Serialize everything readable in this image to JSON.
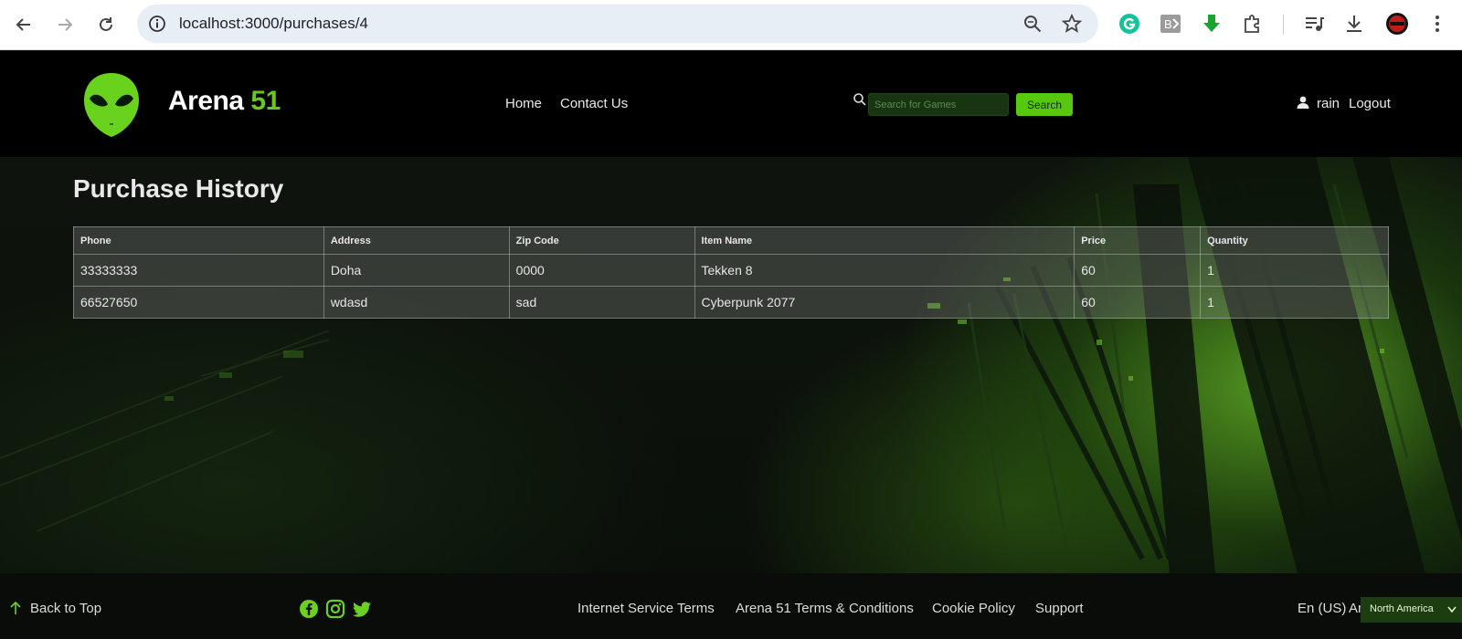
{
  "browser": {
    "url": "localhost:3000/purchases/4"
  },
  "header": {
    "brand_main": "Arena",
    "brand_accent": "51",
    "nav": [
      "Home",
      "Contact Us"
    ],
    "search_placeholder": "Search for Games",
    "search_button": "Search",
    "user_name": "rain",
    "logout_label": "Logout"
  },
  "page": {
    "title": "Purchase History"
  },
  "table": {
    "columns": [
      "Phone",
      "Address",
      "Zip Code",
      "Item Name",
      "Price",
      "Quantity"
    ],
    "rows": [
      [
        "33333333",
        "Doha",
        "0000",
        "Tekken 8",
        "60",
        "1"
      ],
      [
        "66527650",
        "wdasd",
        "sad",
        "Cyberpunk 2077",
        "60",
        "1"
      ]
    ]
  },
  "footer": {
    "back_to_top": "Back to Top",
    "links": [
      "Internet Service Terms",
      "Arena 51 Terms & Conditions",
      "Cookie Policy",
      "Support"
    ],
    "language": "En (US)",
    "language_overflow": "Ar",
    "region": "North America"
  },
  "colors": {
    "accent": "#66c820",
    "button": "#56c90f",
    "header_bg": "#000000"
  },
  "icons": {
    "social": [
      "facebook-icon",
      "instagram-icon",
      "twitter-icon"
    ]
  }
}
